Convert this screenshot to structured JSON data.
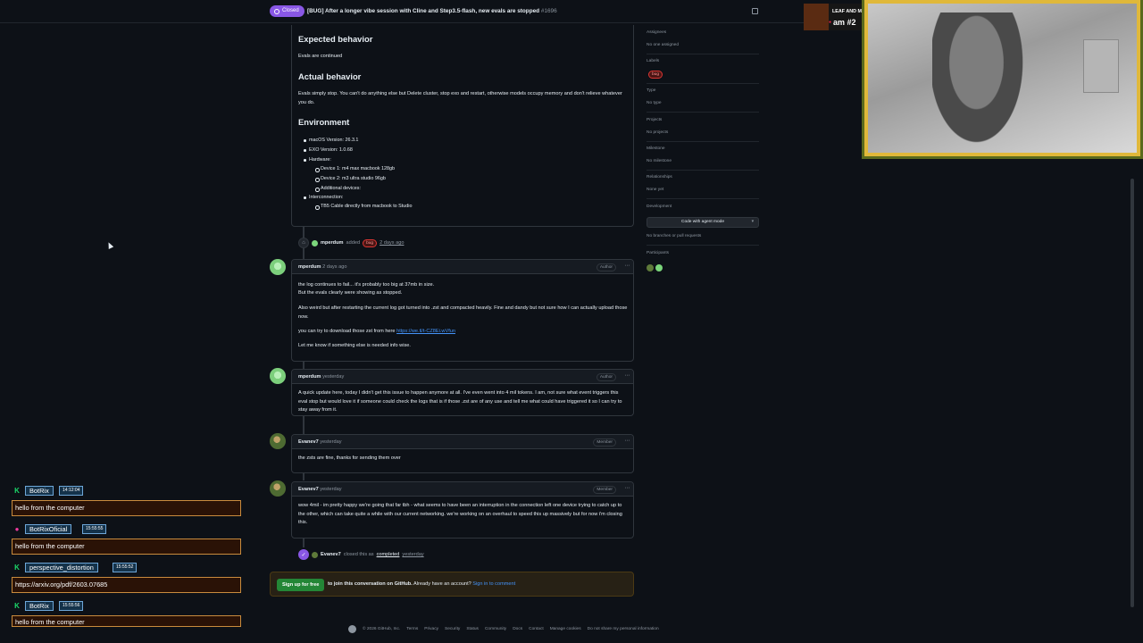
{
  "header": {
    "state_label": "Closed",
    "issue_title": "[BUG] After a longer vibe session with Cline and Step3.5-flash, new evals are stopped",
    "issue_number": "#1696"
  },
  "body": {
    "expected_heading": "Expected behavior",
    "expected_text": "Evals are continued",
    "actual_heading": "Actual behavior",
    "actual_text": "Evals simply stop. You can't do anything else but Delete cluster, stop exo and restart, otherwise models occupy memory and don't relieve whatever you do.",
    "environment_heading": "Environment",
    "env_items": {
      "macos": "macOS Version: 26.3.1",
      "exo": "EXO Version: 1.0.68",
      "hardware": "Hardware:",
      "device1": "Device 1: m4 max macbook 128gb",
      "device2": "Device 2: m3 ultra studio 96gb",
      "additional": "Additional devices:",
      "interconnection": "Interconnection:",
      "tb5": "TB5 Cable directly from macbook to Studio"
    }
  },
  "label_event": {
    "actor": "mperdum",
    "verb": "added",
    "label": "bug",
    "time": "2 days ago"
  },
  "comments": [
    {
      "author": "mperdum",
      "time": "2 days ago",
      "role": "Author",
      "p1": "the log continues to fail... it's probably too big at 37mb in size.",
      "p2": "But the evals clearly were showing as stopped.",
      "p3": "Also weird but after restarting the current log got turned into .zst and compacted heavily. Fine and dandy but not sure how I can actually upload those now.",
      "p4": "you can try to download those zst from here",
      "link": "https://we.tl/t-CZ8Ei.wVfun",
      "p5": "Let me know if something else is needed info wise."
    },
    {
      "author": "mperdum",
      "time": "yesterday",
      "role": "Author",
      "p1": "A quick update here, today I didn't get this issue to happen anymore at all. I've even went into 4 mil tokens. I am, not sure what event triggers this eval stop but would love it if someone could check the logs that is if those .zst are of any use and tell me what could have triggered it so I can try to stay away from it."
    },
    {
      "author": "Evanev7",
      "time": "yesterday",
      "role": "Member",
      "p1": "the zsts are fine, thanks for sending them over"
    },
    {
      "author": "Evanev7",
      "time": "yesterday",
      "role": "Member",
      "p1": "wow 4mil - im pretty happy we're going that far tbh - what seems to have been an interruption in the connection left one device trying to catch up to the other, which can take quite a while with our current networking. we're working on an overhaul to speed this up massively but for now i'm closing this."
    }
  ],
  "close_event": {
    "actor": "Evanev7",
    "verb": "closed this as",
    "state": "completed",
    "time": "yesterday"
  },
  "join": {
    "button": "Sign up for free",
    "text": "to join this conversation on GitHub.",
    "already": "Already have an account?",
    "signin": "Sign in to comment"
  },
  "footer": [
    "© 2026 GitHub, Inc.",
    "Terms",
    "Privacy",
    "Security",
    "Status",
    "Community",
    "Docs",
    "Contact",
    "Manage cookies",
    "Do not share my personal information"
  ],
  "sidebar": {
    "assignees_h": "Assignees",
    "assignees_v": "No one assigned",
    "labels_h": "Labels",
    "labels_v": "bug",
    "type_h": "Type",
    "type_v": "No type",
    "projects_h": "Projects",
    "projects_v": "No projects",
    "milestone_h": "Milestone",
    "milestone_v": "No milestone",
    "relationships_h": "Relationships",
    "relationships_v": "None yet",
    "development_h": "Development",
    "agent_button": "Code with agent mode",
    "dev_v": "No branches or pull requests",
    "participants_h": "Participants"
  },
  "stream": {
    "cam_title": "LEAF AND MACHINE",
    "cam_sub": "am #2"
  },
  "chat": [
    {
      "user": "BotRix",
      "time": "14:12:04",
      "msg": "hello from the computer",
      "icon": "green-k-icon"
    },
    {
      "user": "BotRixOficial",
      "time": "15:55:55",
      "msg": "hello from the computer",
      "icon": "pink-badge-icon"
    },
    {
      "user": "perspective_distortion",
      "time": "15:55:52",
      "msg": "https://arxiv.org/pdf/2603.07685",
      "icon": "green-k-icon"
    },
    {
      "user": "BotRix",
      "time": "15:55:56",
      "msg": "hello from the computer",
      "icon": "green-k-icon"
    }
  ],
  "colors": {
    "bg": "#0d1117",
    "closed_purple": "#8957e5",
    "link_blue": "#4493f8",
    "signup_green": "#238636",
    "bug_red": "#da3633"
  }
}
